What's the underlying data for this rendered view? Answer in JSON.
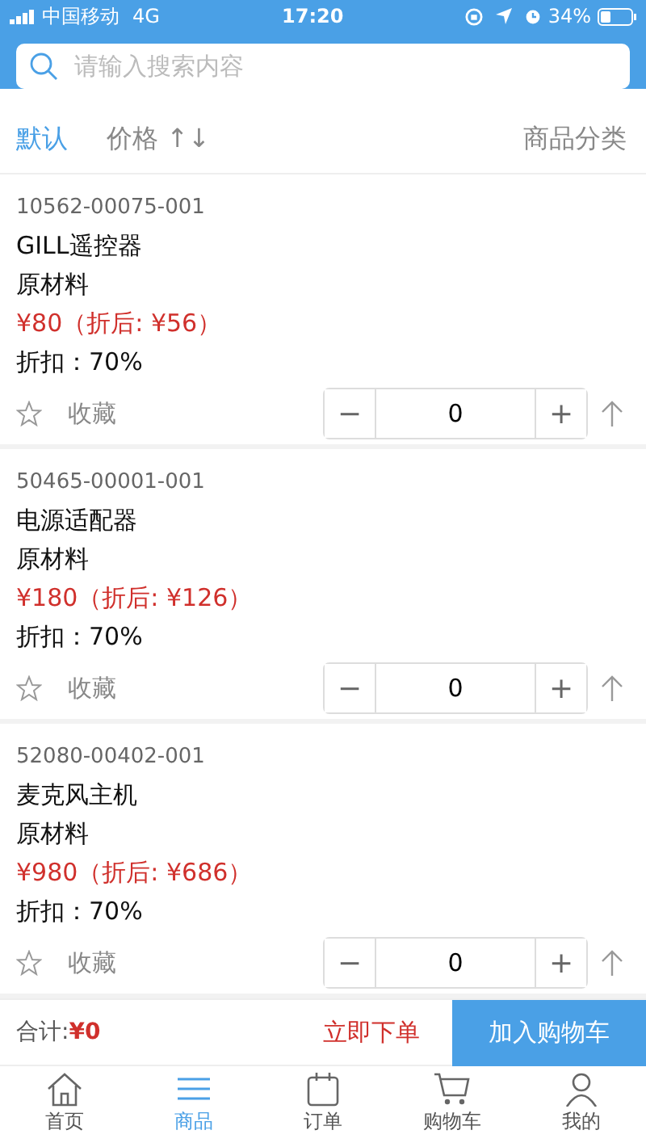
{
  "status_bar": {
    "carrier": "中国移动",
    "network": "4G",
    "time": "17:20",
    "battery": "34%"
  },
  "search": {
    "placeholder": "请输入搜索内容"
  },
  "sort_bar": {
    "options": [
      {
        "label": "默认",
        "selected": true
      },
      {
        "label": "价格",
        "arrows": "↑↓",
        "selected": false
      }
    ],
    "category": "商品分类"
  },
  "products": [
    {
      "code": "10562-00075-001",
      "name": "GILL遥控器",
      "category": "原材料",
      "price": "¥80（折后: ¥56）",
      "discount": "折扣：70%",
      "favorite_label": "收藏",
      "favorited": false,
      "minus": "−",
      "quantity": "0",
      "plus": "+"
    },
    {
      "code": "50465-00001-001",
      "name": "电源适配器",
      "category": "原材料",
      "price": "¥180（折后: ¥126）",
      "discount": "折扣：70%",
      "favorite_label": "收藏",
      "favorited": false,
      "minus": "−",
      "quantity": "0",
      "plus": "+"
    },
    {
      "code": "52080-00402-001",
      "name": "麦克风主机",
      "category": "原材料",
      "price": "¥980（折后: ¥686）",
      "discount": "折扣：70%",
      "favorite_label": "收藏",
      "favorited": false,
      "minus": "−",
      "quantity": "0",
      "plus": "+"
    }
  ],
  "footer": {
    "total_label": "合计:",
    "total": "¥0",
    "order_button": "立即下单",
    "cart_button": "加入购物车"
  },
  "tab_bar": [
    {
      "kind": "home",
      "label": "首页",
      "selected": false
    },
    {
      "kind": "goods",
      "label": "商品",
      "selected": true
    },
    {
      "kind": "orders",
      "label": "订单",
      "selected": false
    },
    {
      "kind": "cart",
      "label": "购物车",
      "selected": false
    },
    {
      "kind": "me",
      "label": "我的",
      "selected": false
    }
  ]
}
